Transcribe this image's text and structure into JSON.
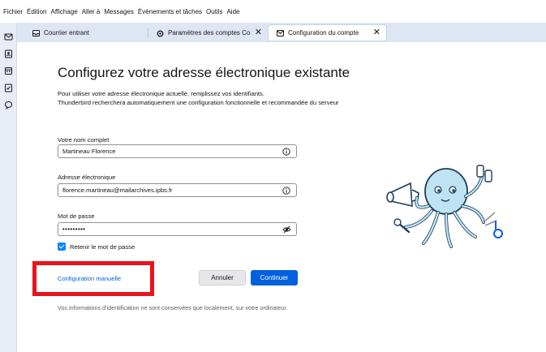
{
  "menubar": {
    "items": [
      "Fichier",
      "Édition",
      "Affichage",
      "Aller à",
      "Messages",
      "Évènements et tâches",
      "Outils",
      "Aide"
    ]
  },
  "tabs": [
    {
      "label": "Courrier entrant",
      "icon": "inbox-icon",
      "active": false
    },
    {
      "label": "Paramètres des comptes Co",
      "icon": "gear-icon",
      "active": false,
      "close": "✕"
    },
    {
      "label": "Configuration du compte",
      "icon": "mail-icon",
      "active": true,
      "close": "✕"
    }
  ],
  "sidebar": {
    "icons": [
      "mail-icon",
      "address-book-icon",
      "calendar-icon",
      "tasks-icon",
      "chat-icon"
    ]
  },
  "page": {
    "title": "Configurez votre adresse électronique existante",
    "intro_line1": "Pour utiliser votre adresse électronique actuelle, remplissez vos identifiants.",
    "intro_line2": "Thunderbird recherchera automatiquement une configuration fonctionnelle et recommandée du serveur"
  },
  "form": {
    "name_label": "Votre nom complet",
    "name_value": "Martineau Florence",
    "email_label": "Adresse électronique",
    "email_value": "florence.martineau@mailarchives.ipbs.fr",
    "password_label": "Mot de passe",
    "password_value": "•••••••••",
    "remember_label": "Retenir le mot de passe",
    "remember_checked": true
  },
  "actions": {
    "manual_config": "Configuration manuelle",
    "cancel": "Annuler",
    "continue": "Continuer"
  },
  "footer": {
    "note": "Vos informations d'identification ne sont conservées que localement, sur votre ordinateur."
  },
  "colors": {
    "accent": "#0060df",
    "highlight": "#e8141b",
    "tabbar": "#dfe6f3"
  }
}
